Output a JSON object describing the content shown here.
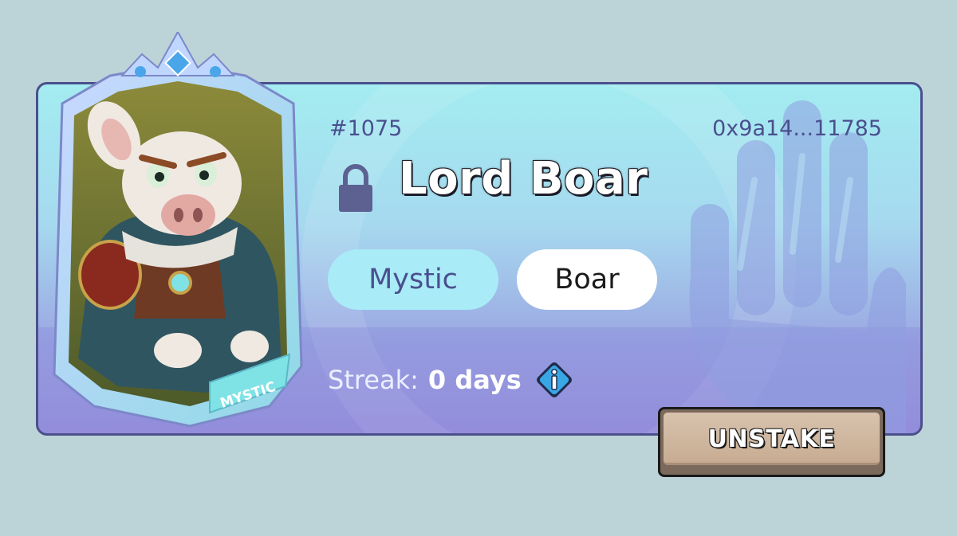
{
  "nft": {
    "token_id": "#1075",
    "owner_address": "0x9a14...11785",
    "name": "Lord Boar",
    "class_tag": "Mystic",
    "type_tag": "Boar",
    "card_rarity_label": "MYSTIC",
    "locked": true
  },
  "streak": {
    "label": "Streak:",
    "value": "0 days"
  },
  "actions": {
    "unstake_label": "UNSTAKE"
  },
  "icons": {
    "lock": "lock-icon",
    "info": "info-icon",
    "background": "hand-icon"
  },
  "colors": {
    "page_bg": "#bcd3d8",
    "card_border": "#4b4f8c",
    "text_primary": "#4a4f8e",
    "chip_class_bg": "#a9ebf6",
    "button_face": "#c7ac92"
  }
}
